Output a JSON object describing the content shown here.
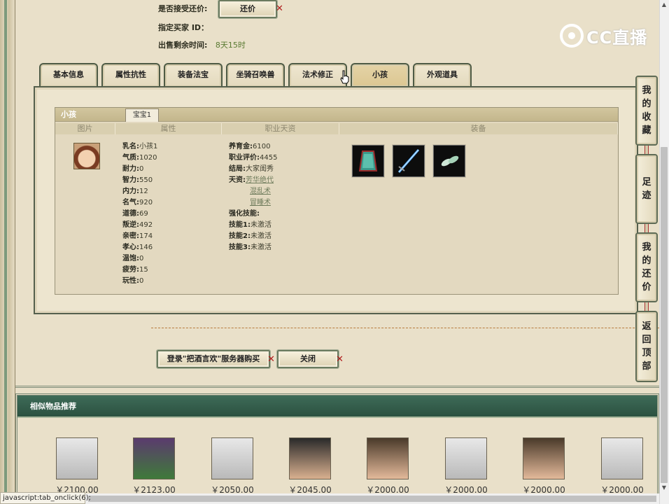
{
  "top": {
    "counter_offer_label": "是否接受还价:",
    "counter_offer_button": "还价",
    "buyer_id_label": "指定买家 ID：",
    "time_left_label": "出售剩余时间:",
    "time_left_value": "8天15时"
  },
  "logo": {
    "text": "CC直播"
  },
  "tabs": [
    {
      "label": "基本信息"
    },
    {
      "label": "属性抗性"
    },
    {
      "label": "装备法宝"
    },
    {
      "label": "坐骑召唤兽"
    },
    {
      "label": "法术修正"
    },
    {
      "label": "小孩",
      "active": true
    },
    {
      "label": "外观道具"
    }
  ],
  "child_panel": {
    "title": "小孩",
    "sub_tab": "宝宝1",
    "columns": [
      "图片",
      "属性",
      "职业天资",
      "装备"
    ],
    "attributes": [
      {
        "k": "乳名:",
        "v": "小孩1"
      },
      {
        "k": "气质:",
        "v": "1020"
      },
      {
        "k": "耐力:",
        "v": "0"
      },
      {
        "k": "智力:",
        "v": "550"
      },
      {
        "k": "内力:",
        "v": "12"
      },
      {
        "k": "名气:",
        "v": "920"
      },
      {
        "k": "道德:",
        "v": "69"
      },
      {
        "k": "叛逆:",
        "v": "492"
      },
      {
        "k": "亲密:",
        "v": "174"
      },
      {
        "k": "孝心:",
        "v": "146"
      },
      {
        "k": "温饱:",
        "v": "0"
      },
      {
        "k": "疲劳:",
        "v": "15"
      },
      {
        "k": "玩性:",
        "v": "0"
      }
    ],
    "career": {
      "raise_gold_k": "养育金:",
      "raise_gold_v": "6100",
      "rating_k": "职业评价:",
      "rating_v": "4455",
      "ending_k": "结局:",
      "ending_v": "大家闺秀",
      "talent_k": "天资:",
      "talents": [
        "芳华绝代",
        "混乱术",
        "冒睡术"
      ],
      "skills_k": "强化技能:",
      "skills": [
        {
          "k": "技能1:",
          "v": "未激活"
        },
        {
          "k": "技能2:",
          "v": "未激活"
        },
        {
          "k": "技能3:",
          "v": "未激活"
        }
      ]
    },
    "equipment_icons": [
      "robe-icon",
      "sword-icon",
      "charm-icon"
    ]
  },
  "actions": {
    "login_buy_button": "登录\"把酒言欢\"服务器购买",
    "close_button": "关闭"
  },
  "side_buttons": [
    {
      "name": "favorites",
      "chars": [
        "我",
        "的",
        "收",
        "藏"
      ]
    },
    {
      "name": "footprints",
      "chars": [
        "足",
        "迹"
      ]
    },
    {
      "name": "my-counter-offers",
      "chars": [
        "我",
        "的",
        "还",
        "价"
      ]
    },
    {
      "name": "back-to-top",
      "chars": [
        "返",
        "回",
        "顶",
        "部"
      ]
    }
  ],
  "recommend": {
    "title": "相似物品推荐",
    "items": [
      {
        "price": "￥2100.00",
        "avatar": "white-hair"
      },
      {
        "price": "￥2123.00",
        "avatar": "purple-hair"
      },
      {
        "price": "￥2050.00",
        "avatar": "white-hair"
      },
      {
        "price": "￥2045.00",
        "avatar": "dark-hair"
      },
      {
        "price": "￥2000.00",
        "avatar": "short-hair"
      },
      {
        "price": "￥2000.00",
        "avatar": "white-hair"
      },
      {
        "price": "￥2000.00",
        "avatar": "short-hair"
      },
      {
        "price": "￥2000.00",
        "avatar": "white-hair"
      }
    ]
  },
  "statusbar": {
    "text": "javascript:tab_onclick(6);"
  }
}
